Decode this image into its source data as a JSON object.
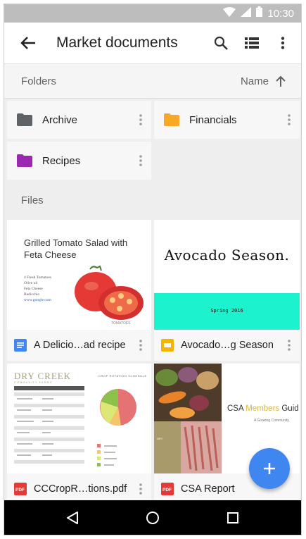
{
  "status_bar": {
    "time": "10:30"
  },
  "app_bar": {
    "title": "Market documents"
  },
  "sort_bar": {
    "section_label": "Folders",
    "sort_field": "Name"
  },
  "folders": [
    {
      "name": "Archive",
      "color": "#5f6368"
    },
    {
      "name": "Financials",
      "color": "#f9a825"
    },
    {
      "name": "Recipes",
      "color": "#9c27b0"
    }
  ],
  "files_label": "Files",
  "files": [
    {
      "name": "A Delicio…ad recipe",
      "type_icon": "google-docs-icon",
      "icon_color": "#4285f4",
      "thumbnail": {
        "title": "Grilled Tomato Salad with Feta Cheese",
        "list": [
          "4 Fresh Tomatoes",
          "Olive oil",
          "Feta Cheese",
          "Radicchio",
          "www.google.com"
        ]
      }
    },
    {
      "name": "Avocado…g Season",
      "type_icon": "google-slides-icon",
      "icon_color": "#f4b400",
      "thumbnail": {
        "title": "Avocado Season.",
        "band_text": "Spring 2016",
        "band_color": "#1df2cf"
      }
    },
    {
      "name": "CCCropR…tions.pdf",
      "type_icon": "pdf-icon",
      "icon_color": "#e53935",
      "thumbnail": {
        "title": "DRY CREEK",
        "subtitle": "COMMUNITY FARMS",
        "heading": "CROP ROTATION SCHEDULE"
      }
    },
    {
      "name": "CSA Report",
      "type_icon": "pdf-icon",
      "icon_color": "#e53935",
      "thumbnail": {
        "title_pre": "CSA ",
        "title_highlight": "Members",
        "title_post": " Guid",
        "subtitle": "A Growing Community"
      }
    }
  ],
  "colors": {
    "accent": "#3f86f0",
    "status_bar": "#bdbdbd",
    "background": "#eeeeee"
  }
}
